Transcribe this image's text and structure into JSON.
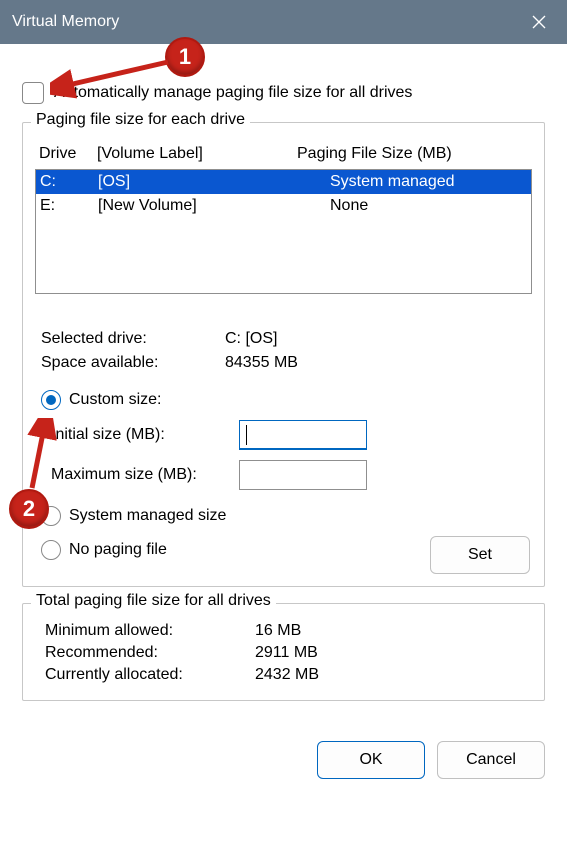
{
  "title": "Virtual Memory",
  "auto_manage_label": "Automatically manage paging file size for all drives",
  "group_each_drive": {
    "legend": "Paging file size for each drive",
    "headers": {
      "drive": "Drive",
      "volume": "[Volume Label]",
      "size": "Paging File Size (MB)"
    },
    "rows": [
      {
        "drive": "C:",
        "volume": "[OS]",
        "size": "System managed",
        "selected": true
      },
      {
        "drive": "E:",
        "volume": "[New Volume]",
        "size": "None",
        "selected": false
      }
    ],
    "selected_drive_label": "Selected drive:",
    "selected_drive_value": "C:  [OS]",
    "space_label": "Space available:",
    "space_value": "84355 MB",
    "opt_custom": "Custom size:",
    "initial_label": "Initial size (MB):",
    "initial_value": "",
    "max_label": "Maximum size (MB):",
    "max_value": "",
    "opt_system": "System managed size",
    "opt_none": "No paging file",
    "set_btn": "Set"
  },
  "group_totals": {
    "legend": "Total paging file size for all drives",
    "min_label": "Minimum allowed:",
    "min_value": "16 MB",
    "rec_label": "Recommended:",
    "rec_value": "2911 MB",
    "cur_label": "Currently allocated:",
    "cur_value": "2432 MB"
  },
  "ok_btn": "OK",
  "cancel_btn": "Cancel",
  "annotations": {
    "n1": "1",
    "n2": "2"
  }
}
